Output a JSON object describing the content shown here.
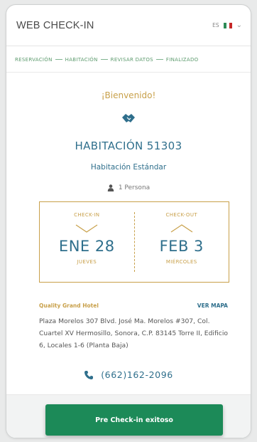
{
  "header": {
    "title": "WEB CHECK-IN",
    "language_code": "ES",
    "flag_colors": [
      "#2e8b57",
      "#ffffff",
      "#c62828"
    ]
  },
  "steps": [
    "RESERVACIÓN",
    "HABITACIÓN",
    "REVISAR DATOS",
    "FINALIZADO"
  ],
  "welcome": "¡Bienvenido!",
  "room": {
    "number": "HABITACIÓN 51303",
    "type": "Habitación Estándar",
    "guests": "1 Persona"
  },
  "checkin": {
    "label": "CHECK-IN",
    "date": "ENE 28",
    "weekday": "JUEVES"
  },
  "checkout": {
    "label": "CHECK-OUT",
    "date": "FEB 3",
    "weekday": "MIÉRCOLES"
  },
  "hotel": {
    "name": "Quality Grand Hotel",
    "map_link": "VER MAPA",
    "address": "Plaza Morelos 307 Blvd. José Ma. Morelos #307, Col. Cuartel XV Hermosillo, Sonora, C.P. 83145 Torre II, Edificio 6, Locales 1-6 (Planta Baja)",
    "phone": "(662)162-2096"
  },
  "cta_label": "Pre Check-in exitoso",
  "colors": {
    "gold": "#c8a04a",
    "blue": "#2f6f8c",
    "green": "#1c8a58",
    "step_green": "#5d9b6e"
  }
}
